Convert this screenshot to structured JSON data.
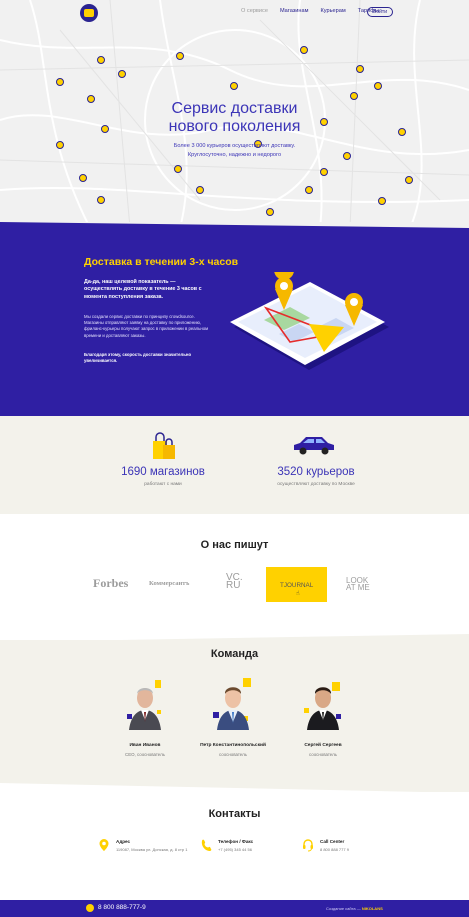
{
  "header": {
    "nav": [
      "О сервисе",
      "Магазинам",
      "Курьерам",
      "Тарифы"
    ],
    "login": "Войти"
  },
  "hero": {
    "title": "Сервис доставки нового поколения",
    "subtitle": "Более 3 000 курьеров осуществляют доставку. Круглосуточно, надежно и недорого"
  },
  "delivery": {
    "title": "Доставка в течении 3-х часов",
    "lead": "Да-да, наш целевой показатель — осуществлять доставку в течение 3 часов с момента поступления заказа.",
    "text": "Мы создали сервис доставки по принципу crowdsource. Магазины отправляют заявку на доставку по приложению, фриланс-курьеры получают запрос в приложении в реальном времени и доставляют заказы.",
    "note": "Благодаря этому, скорость доставки значительно увеличивается."
  },
  "stats": [
    {
      "number": "1690 магазинов",
      "caption": "работают с нами"
    },
    {
      "number": "3520 курьеров",
      "caption": "осуществляют доставку по Москве"
    }
  ],
  "press": {
    "title": "О нас пишут",
    "logos": [
      "Forbes",
      "Коммерсантъ",
      "VC.RU",
      "TJOURNAL",
      "LOOK AT ME"
    ]
  },
  "team": {
    "title": "Команда",
    "members": [
      {
        "name": "Иван Иванов",
        "role": "CEO, сооснователь"
      },
      {
        "name": "Петр Константинопольский",
        "role": "сооснователь"
      },
      {
        "name": "Сергей Сергеев",
        "role": "сооснователь"
      }
    ]
  },
  "contacts": {
    "title": "Контакты",
    "items": [
      {
        "label": "Адрес",
        "value": "119087, Москва ул. Донская, д. 8 стр 1",
        "icon": "location-pin-icon"
      },
      {
        "label": "Телефон / Факс",
        "value": "+7 (495) 345 44 56",
        "icon": "phone-icon"
      },
      {
        "label": "Call Center",
        "value": "8 800 888 777 9",
        "icon": "headset-icon"
      }
    ]
  },
  "footer": {
    "phone": "8 800 888-777-9",
    "credit_prefix": "Создание сайта —",
    "credit_brand": "NIKOLANS"
  },
  "colors": {
    "brand_purple": "#2f1fa3",
    "brand_yellow": "#ffd100",
    "text_blue": "#3c35b7"
  }
}
